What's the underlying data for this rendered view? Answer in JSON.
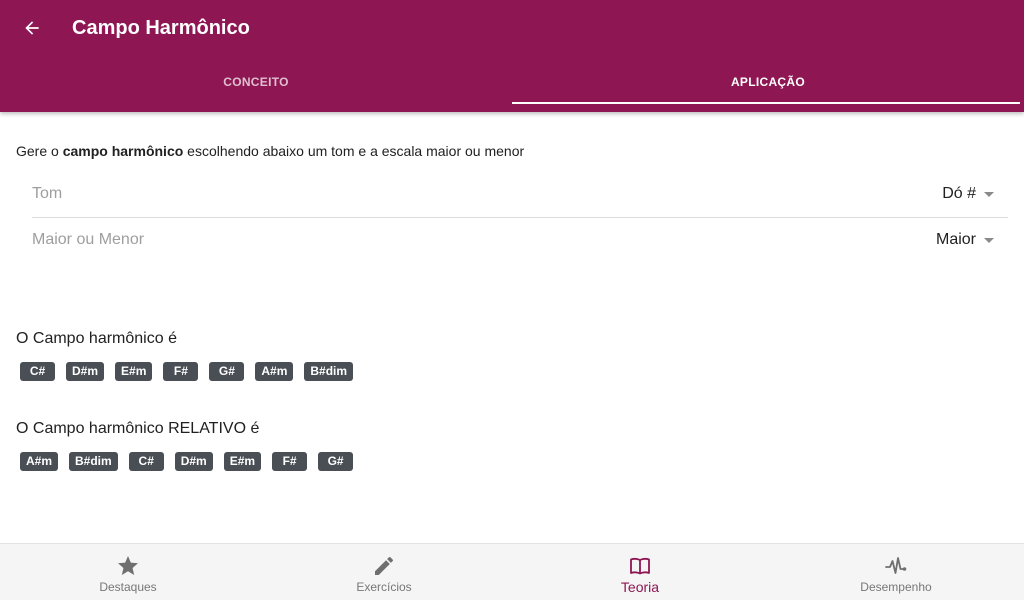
{
  "header": {
    "title": "Campo Harmônico",
    "back_icon": "arrow-back-icon"
  },
  "tabs": [
    {
      "label": "CONCEITO",
      "active": false
    },
    {
      "label": "APLICAÇÃO",
      "active": true
    }
  ],
  "intro": {
    "prefix": "Gere o ",
    "bold": "campo harmônico",
    "suffix": " escolhendo abaixo um tom e a escala maior ou menor"
  },
  "selects": [
    {
      "label": "Tom",
      "value": "Dó #"
    },
    {
      "label": "Maior ou Menor",
      "value": "Maior"
    }
  ],
  "field": {
    "title": "O Campo harmônico é",
    "chords": [
      "C#",
      "D#m",
      "E#m",
      "F#",
      "G#",
      "A#m",
      "B#dim"
    ]
  },
  "relative_field": {
    "title": "O Campo harmônico RELATIVO é",
    "chords": [
      "A#m",
      "B#dim",
      "C#",
      "D#m",
      "E#m",
      "F#",
      "G#"
    ]
  },
  "bottom_nav": [
    {
      "label": "Destaques",
      "icon": "star-icon",
      "active": false
    },
    {
      "label": "Exercícios",
      "icon": "pencil-icon",
      "active": false
    },
    {
      "label": "Teoria",
      "icon": "book-icon",
      "active": true
    },
    {
      "label": "Desempenho",
      "icon": "pulse-icon",
      "active": false
    }
  ],
  "colors": {
    "primary": "#8e1753",
    "chip": "#4a4f55",
    "nav_inactive": "#777777"
  }
}
